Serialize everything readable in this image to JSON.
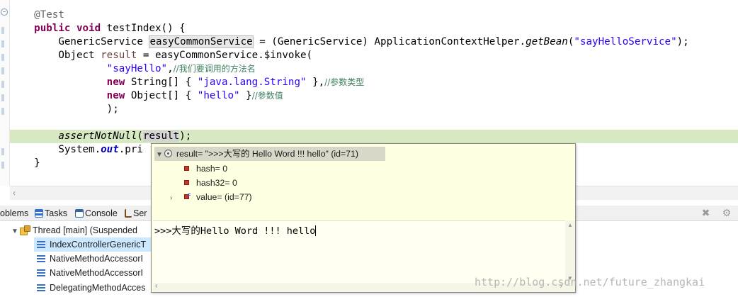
{
  "editor": {
    "lines": {
      "l1": {
        "annotation": "@Test"
      },
      "l2": {
        "kw_public": "public",
        "kw_void": "void",
        "text": " testIndex() {"
      },
      "l3": {
        "p1": "GenericService ",
        "var": "easyCommonService",
        "p2": " = (GenericService) ApplicationContextHelper.",
        "method": "getBean",
        "p3": "(",
        "str": "\"sayHelloService\"",
        "p4": ");"
      },
      "l4": {
        "p1": "Object ",
        "var": "result",
        "p2": " = easyCommonService.$invoke("
      },
      "l5": {
        "str": "\"sayHello\"",
        "p1": ",",
        "comment": "//我们要调用的方法名"
      },
      "l6": {
        "kw": "new",
        "p1": " String[] { ",
        "str": "\"java.lang.String\"",
        "p2": " },",
        "comment": "//参数类型"
      },
      "l7": {
        "kw": "new",
        "p1": " Object[] { ",
        "str": "\"hello\"",
        "p2": " }",
        "comment": "//参数值"
      },
      "l8": {
        "text": ");"
      },
      "l9": {
        "text": ""
      },
      "l10": {
        "method": "assertNotNull",
        "p1": "(",
        "var": "result",
        "p2": ");"
      },
      "l11": {
        "p1": "System.",
        "field": "out",
        "p2": ".pri"
      },
      "l12": {
        "text": "}"
      }
    }
  },
  "views": {
    "tabs": [
      {
        "label": "oblems",
        "icon": "problems-icon"
      },
      {
        "label": "Tasks",
        "icon": "tasks-icon"
      },
      {
        "label": "Console",
        "icon": "console-icon"
      },
      {
        "label": "Ser",
        "icon": "servers-icon"
      }
    ],
    "tools": [
      "remove-all-terminated-icon",
      "debug-options-icon"
    ]
  },
  "debug": {
    "thread": {
      "label": "Thread [main] (Suspended"
    },
    "frames": [
      {
        "label": "IndexControllerGenericT"
      },
      {
        "label": "NativeMethodAccessorI"
      },
      {
        "label": "NativeMethodAccessorI"
      },
      {
        "label": "DelegatingMethodAcces"
      }
    ]
  },
  "inspect": {
    "root": {
      "label": "result= \">>>大写的 Hello Word !!! hello\" (id=71)"
    },
    "children": [
      {
        "label": "hash= 0"
      },
      {
        "label": "hash32= 0"
      },
      {
        "label": "value= (id=77)"
      }
    ],
    "detail": ">>>大写的Hello Word !!! hello"
  },
  "watermark": "http://blog.csdn.net/future_zhangkai",
  "colors": {
    "keyword": "#7f0055",
    "string": "#2a00ff",
    "comment": "#3f7f5f",
    "field": "#0000c0",
    "highlight_line": "#d7e9c3",
    "popup_bg": "#ffffe1"
  }
}
